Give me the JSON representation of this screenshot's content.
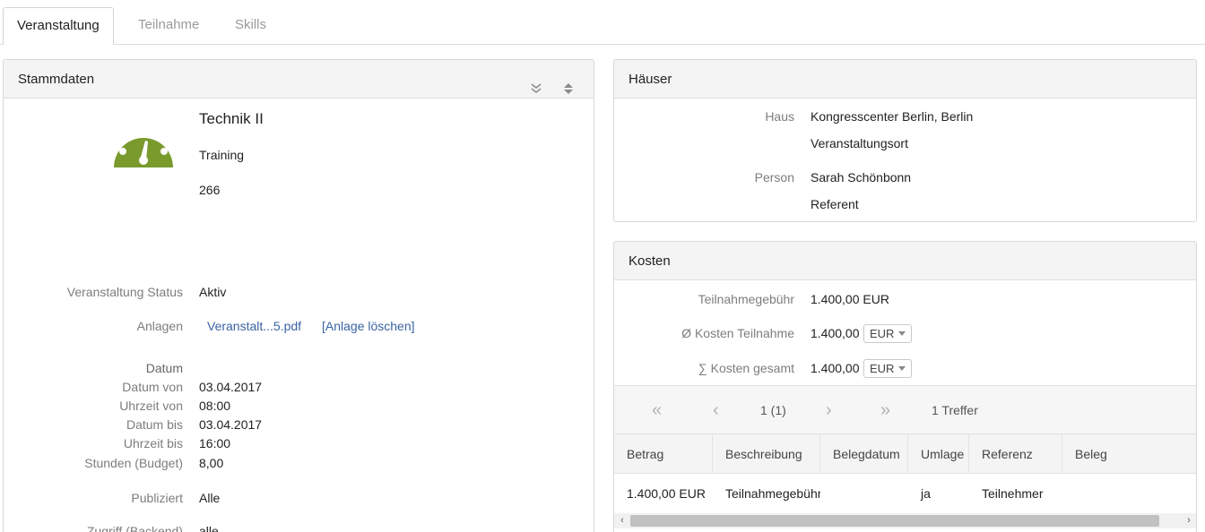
{
  "tabs": [
    {
      "label": "Veranstaltung",
      "active": true
    },
    {
      "label": "Teilnahme",
      "active": false
    },
    {
      "label": "Skills",
      "active": false
    }
  ],
  "stammdaten": {
    "title": "Stammdaten",
    "icon": "speedometer-icon",
    "icon_color": "#7a9a2e",
    "name": "Technik II",
    "type": "Training",
    "number": "266",
    "status_label": "Veranstaltung Status",
    "status_value": "Aktiv",
    "anlagen_label": "Anlagen",
    "anlage_file": "Veranstalt...5.pdf",
    "anlage_delete": "[Anlage löschen]",
    "datum_heading": "Datum",
    "datum_von_label": "Datum von",
    "datum_von": "03.04.2017",
    "uhrzeit_von_label": "Uhrzeit von",
    "uhrzeit_von": "08:00",
    "datum_bis_label": "Datum bis",
    "datum_bis": "03.04.2017",
    "uhrzeit_bis_label": "Uhrzeit bis",
    "uhrzeit_bis": "16:00",
    "stunden_label": "Stunden (Budget)",
    "stunden": "8,00",
    "publiziert_label": "Publiziert",
    "publiziert": "Alle",
    "zugriff_label": "Zugriff (Backend)",
    "zugriff": "alle"
  },
  "haeuser": {
    "title": "Häuser",
    "haus_label": "Haus",
    "haus_value": "Kongresscenter Berlin, Berlin",
    "haus_role": "Veranstaltungsort",
    "person_label": "Person",
    "person_value": "Sarah Schönbonn",
    "person_role": "Referent"
  },
  "kosten": {
    "title": "Kosten",
    "teilnahmegebuehr_label": "Teilnahmegebühr",
    "teilnahmegebuehr": "1.400,00 EUR",
    "kosten_teilnahme_label": "Ø Kosten Teilnahme",
    "kosten_teilnahme": "1.400,00",
    "kosten_teilnahme_currency": "EUR",
    "kosten_gesamt_label": "∑ Kosten gesamt",
    "kosten_gesamt": "1.400,00",
    "kosten_gesamt_currency": "EUR",
    "pager": {
      "first": "«",
      "prev": "‹",
      "page": "1 (1)",
      "next": "›",
      "last": "»",
      "hits": "1 Treffer"
    },
    "columns": [
      "Betrag",
      "Beschreibung",
      "Belegdatum",
      "Umlage",
      "Referenz",
      "Beleg"
    ],
    "rows": [
      [
        "1.400,00 EUR",
        "Teilnahmegebühr",
        "",
        "ja",
        "Teilnehmer",
        ""
      ]
    ],
    "scroll_left": "‹",
    "scroll_right": "›"
  }
}
